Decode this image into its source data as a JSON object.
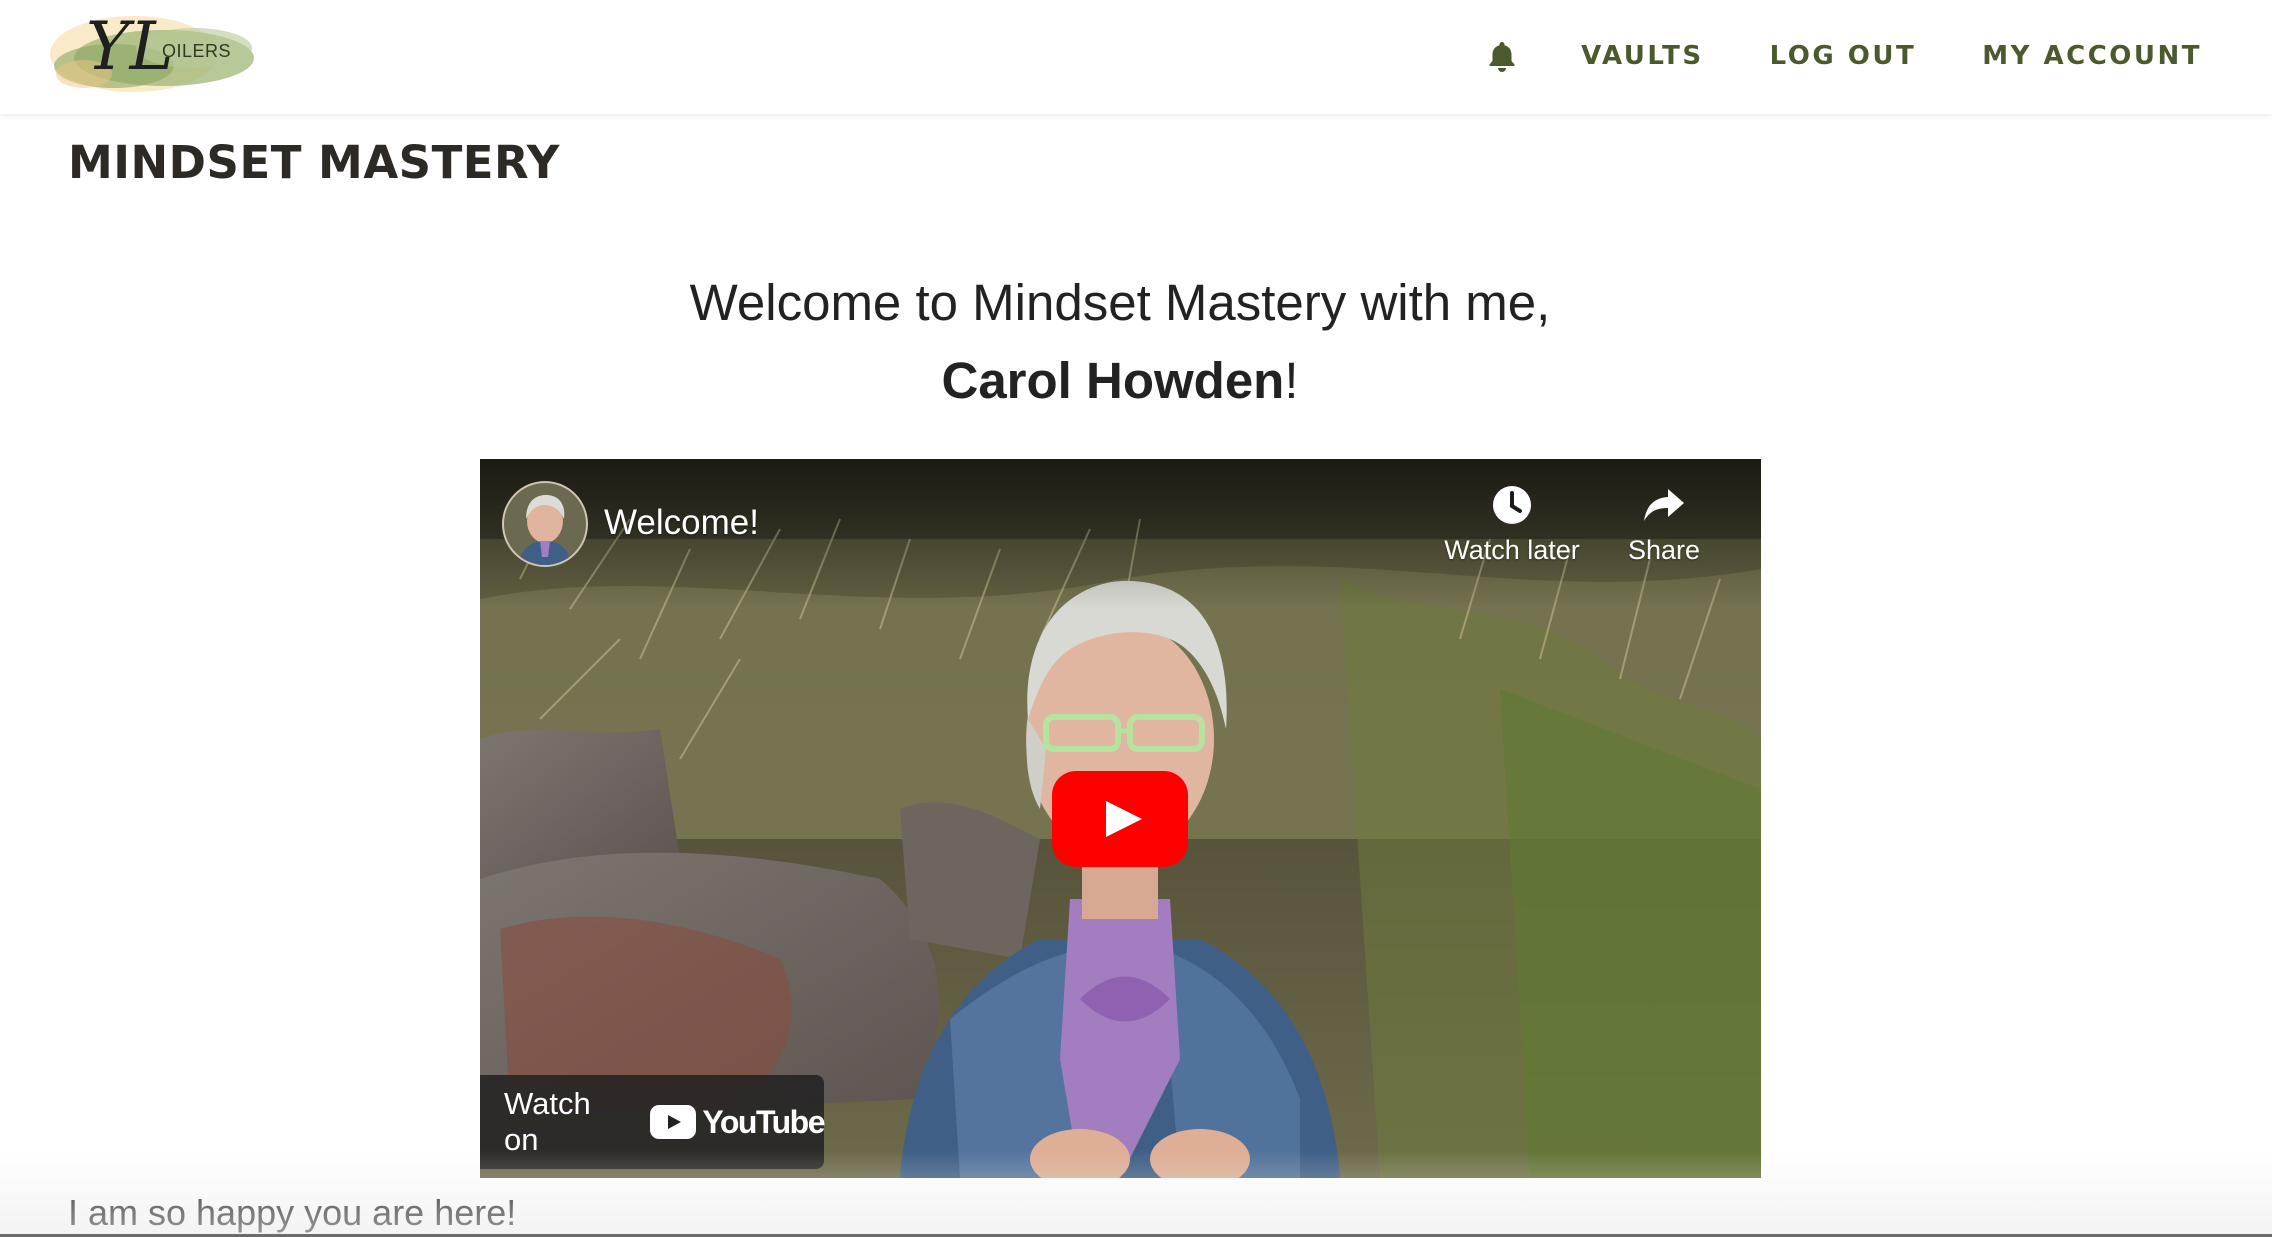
{
  "header": {
    "logo_script": "YL",
    "logo_text": "OILERS",
    "nav": [
      {
        "label": "VAULTS"
      },
      {
        "label": "LOG OUT"
      },
      {
        "label": "MY ACCOUNT"
      }
    ],
    "bell_icon": "bell-icon",
    "accent_color": "#4a5a2c"
  },
  "page": {
    "title": "MINDSET MASTERY",
    "welcome_line1": "Welcome to Mindset Mastery with me,",
    "welcome_name": "Carol Howden",
    "welcome_suffix": "!",
    "body_text": "I am so happy you are here!"
  },
  "video": {
    "title": "Welcome!",
    "watch_later_label": "Watch later",
    "share_label": "Share",
    "watch_on_label": "Watch on",
    "youtube_label": "YouTube",
    "play_color": "#ff0000"
  }
}
